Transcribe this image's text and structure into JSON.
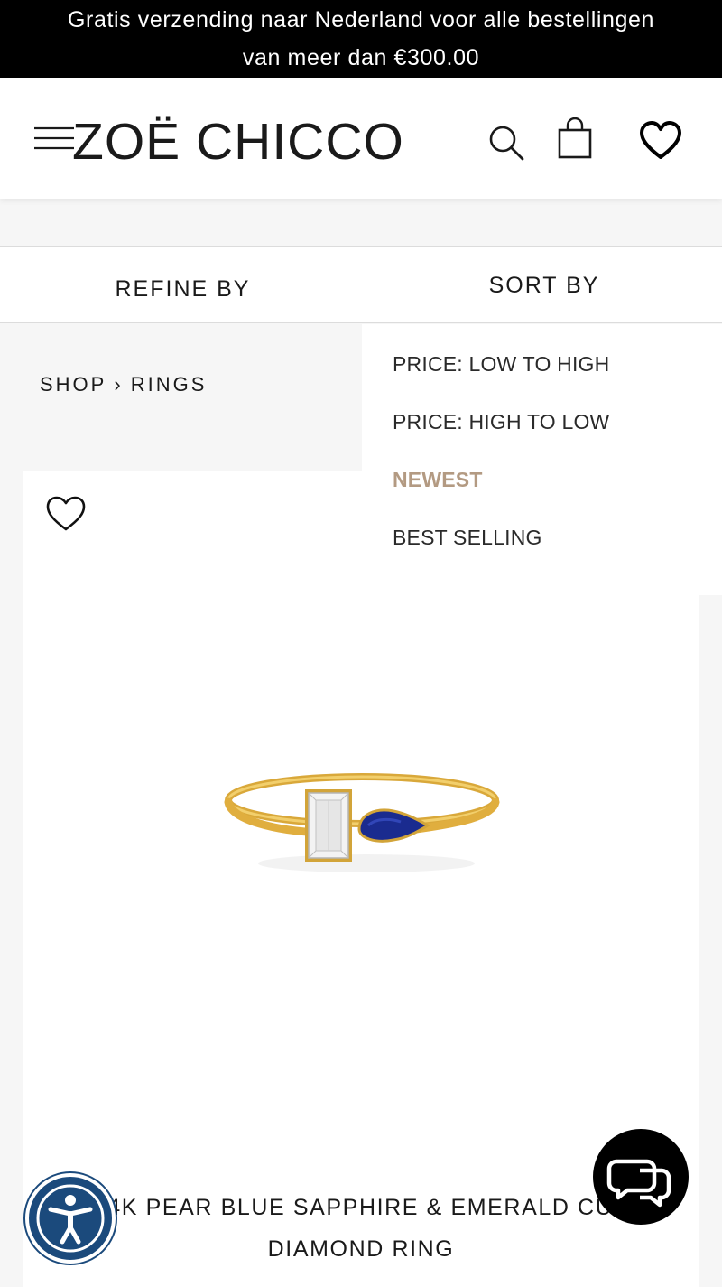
{
  "announcement": {
    "line1": "Gratis verzending naar Nederland voor alle bestellingen",
    "line2": "van meer dan €300.00"
  },
  "header": {
    "logo": "ZOË CHICCO",
    "icons": [
      "menu-icon",
      "search-icon",
      "bag-icon",
      "heart-icon"
    ]
  },
  "toolbar": {
    "refine_label": "REFINE BY",
    "sort_label": "SORT BY"
  },
  "breadcrumb": {
    "shop": "SHOP",
    "separator": "›",
    "current": "RINGS"
  },
  "sort_options": [
    {
      "label": "PRICE: LOW TO HIGH",
      "selected": false
    },
    {
      "label": "PRICE: HIGH TO LOW",
      "selected": false
    },
    {
      "label": "NEWEST",
      "selected": true
    },
    {
      "label": "BEST SELLING",
      "selected": false
    }
  ],
  "product": {
    "name_line1": "14K PEAR BLUE SAPPHIRE & EMERALD CUT",
    "name_line2": "DIAMOND RING"
  },
  "colors": {
    "announcement_bg": "#000000",
    "active_sort": "#b39a82",
    "accessibility_button": "#1b4a7c",
    "chat_button": "#000000",
    "gold": "#e8b94a",
    "sapphire": "#1a2b8f"
  }
}
